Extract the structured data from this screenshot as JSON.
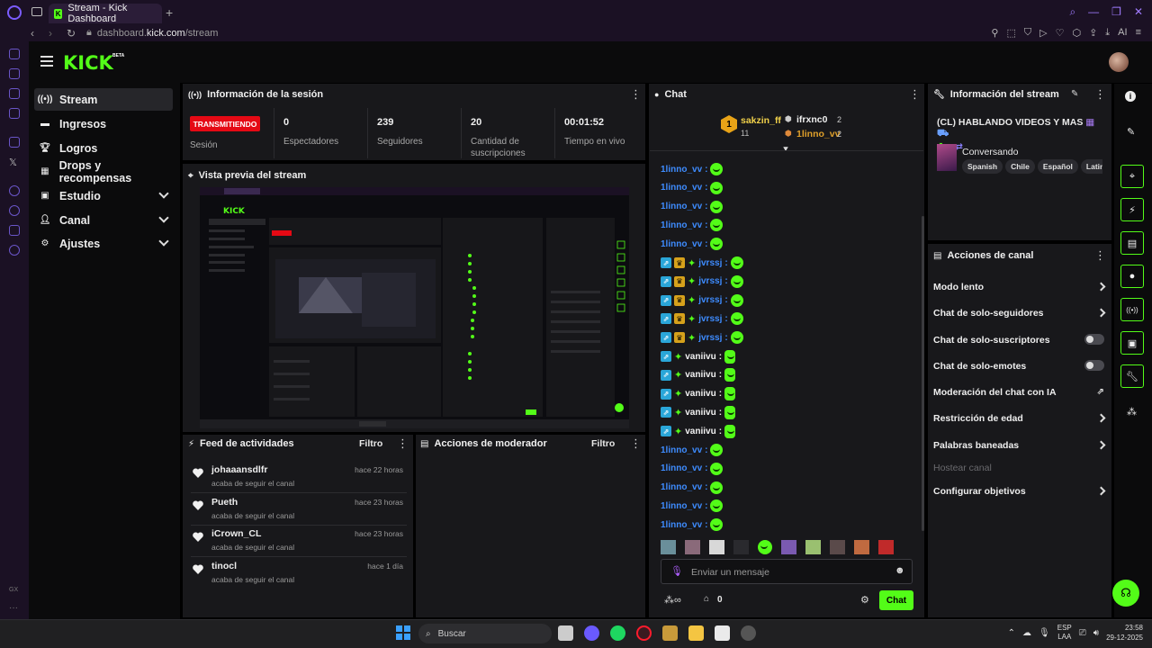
{
  "browser": {
    "tab_title": "Stream - Kick Dashboard",
    "url_prefix": "dashboard.",
    "url_domain": "kick.com",
    "url_path": "/stream",
    "ai_label": "AI"
  },
  "header": {
    "logo": "KICK",
    "beta": "BETA"
  },
  "nav": {
    "items": [
      {
        "label": "Stream",
        "icon": "broadcast-icon"
      },
      {
        "label": "Ingresos",
        "icon": "wallet-icon"
      },
      {
        "label": "Logros",
        "icon": "trophy-icon"
      },
      {
        "label": "Drops y recompensas",
        "icon": "gift-icon"
      },
      {
        "label": "Estudio",
        "icon": "studio-icon"
      },
      {
        "label": "Canal",
        "icon": "user-icon"
      },
      {
        "label": "Ajustes",
        "icon": "gear-icon"
      }
    ]
  },
  "session": {
    "title": "Información de la sesión",
    "status": "TRANSMITIENDO",
    "status_label": "Sesión",
    "stats": [
      {
        "value": "0",
        "label": "Espectadores"
      },
      {
        "value": "239",
        "label": "Seguidores"
      },
      {
        "value": "20",
        "label": "Cantidad de suscripciones"
      },
      {
        "value": "00:01:52",
        "label": "Tiempo en vivo"
      }
    ]
  },
  "preview": {
    "title": "Vista previa del stream"
  },
  "feed": {
    "title": "Feed de actividades",
    "filter": "Filtro",
    "items": [
      {
        "name": "johaaansdlfr",
        "sub": "acaba de seguir el canal",
        "time": "hace 22 horas"
      },
      {
        "name": "Pueth",
        "sub": "acaba de seguir el canal",
        "time": "hace 23 horas"
      },
      {
        "name": "iCrown_CL",
        "sub": "acaba de seguir el canal",
        "time": "hace 23 horas"
      },
      {
        "name": "tinocl",
        "sub": "acaba de seguir el canal",
        "time": "hace 1 día"
      }
    ]
  },
  "moderator": {
    "title": "Acciones de moderador",
    "filter": "Filtro"
  },
  "chat": {
    "title": "Chat",
    "top": [
      {
        "rank": "1",
        "name": "sakzin_ff",
        "count": "11"
      },
      {
        "name": "ifrxnc0",
        "count": "2"
      },
      {
        "name": "1linno_vv",
        "count": "2"
      }
    ],
    "messages": [
      {
        "user": "1linno_vv",
        "type": "plain"
      },
      {
        "user": "1linno_vv",
        "type": "plain"
      },
      {
        "user": "1linno_vv",
        "type": "plain"
      },
      {
        "user": "1linno_vv",
        "type": "plain"
      },
      {
        "user": "1linno_vv",
        "type": "plain"
      },
      {
        "user": "jvrssj",
        "type": "badged"
      },
      {
        "user": "jvrssj",
        "type": "badged"
      },
      {
        "user": "jvrssj",
        "type": "badged"
      },
      {
        "user": "jvrssj",
        "type": "badged"
      },
      {
        "user": "jvrssj",
        "type": "badged"
      },
      {
        "user": "vaniivu",
        "type": "white"
      },
      {
        "user": "vaniivu",
        "type": "white"
      },
      {
        "user": "vaniivu",
        "type": "white"
      },
      {
        "user": "vaniivu",
        "type": "white"
      },
      {
        "user": "vaniivu",
        "type": "white"
      },
      {
        "user": "1linno_vv",
        "type": "plain"
      },
      {
        "user": "1linno_vv",
        "type": "plain"
      },
      {
        "user": "1linno_vv",
        "type": "plain"
      },
      {
        "user": "1linno_vv",
        "type": "plain"
      },
      {
        "user": "1linno_vv",
        "type": "plain"
      }
    ],
    "input_placeholder": "Enviar un mensaje",
    "points": "0",
    "send_label": "Chat"
  },
  "stream_info": {
    "title": "Información del stream",
    "stream_title": "(CL) HABLANDO VIDEOS Y MAS",
    "category": "Conversando",
    "tags": [
      "Spanish",
      "Chile",
      "Español",
      "Latino"
    ]
  },
  "channel_actions": {
    "title": "Acciones de canal",
    "items": [
      {
        "label": "Modo lento",
        "control": "chevron"
      },
      {
        "label": "Chat de solo-seguidores",
        "control": "chevron"
      },
      {
        "label": "Chat de solo-suscriptores",
        "control": "toggle"
      },
      {
        "label": "Chat de solo-emotes",
        "control": "toggle"
      },
      {
        "label": "Moderación del chat con IA",
        "control": "external"
      },
      {
        "label": "Restricción de edad",
        "control": "chevron"
      },
      {
        "label": "Palabras baneadas",
        "control": "chevron"
      },
      {
        "label": "Hostear canal",
        "control": "disabled"
      },
      {
        "label": "Configurar objetivos",
        "control": "chevron"
      }
    ]
  },
  "taskbar": {
    "search_placeholder": "Buscar",
    "lang": "ESP",
    "layout": "LAA",
    "time": "23:58",
    "date": "29-12-2025"
  },
  "colors": {
    "accent": "#53fc18",
    "live": "#e50914",
    "panel": "#18181b",
    "bg": "#0b0b0c"
  }
}
